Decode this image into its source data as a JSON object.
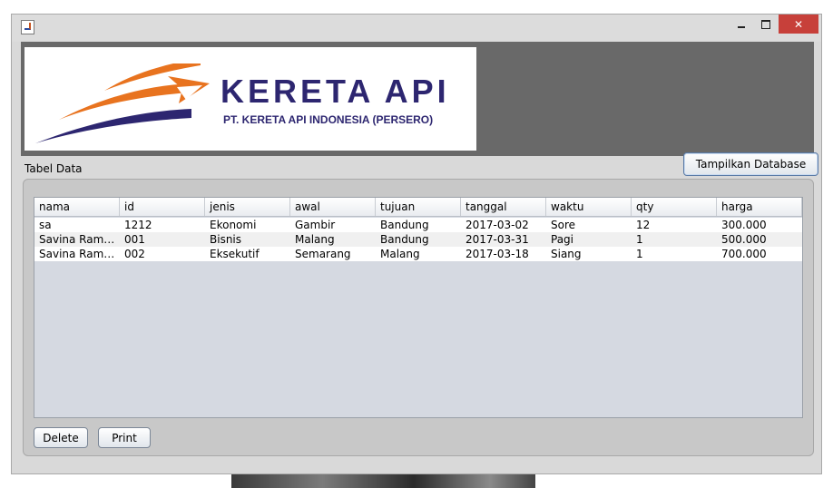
{
  "window": {
    "title": "",
    "controls": {
      "minimize": "minimize-icon",
      "maximize": "maximize-icon",
      "close": "✕"
    }
  },
  "banner": {
    "logo_title": "KERETA API",
    "logo_subtitle": "PT. KERETA API INDONESIA (PERSERO)",
    "show_db_button": "Tampilkan Database",
    "colors": {
      "navy": "#2d2670",
      "orange": "#e8731f",
      "panel": "#696969"
    }
  },
  "section": {
    "label": "Tabel Data"
  },
  "table": {
    "columns": [
      "nama",
      "id",
      "jenis",
      "awal",
      "tujuan",
      "tanggal",
      "waktu",
      "qty",
      "harga"
    ],
    "rows": [
      [
        "sa",
        "1212",
        "Ekonomi",
        "Gambir",
        "Bandung",
        "2017-03-02",
        "Sore",
        "12",
        "300.000"
      ],
      [
        "Savina Ramad...",
        "001",
        "Bisnis",
        "Malang",
        "Bandung",
        "2017-03-31",
        "Pagi",
        "1",
        "500.000"
      ],
      [
        "Savina Ramad...",
        "002",
        "Eksekutif",
        "Semarang",
        "Malang",
        "2017-03-18",
        "Siang",
        "1",
        "700.000"
      ]
    ]
  },
  "actions": {
    "delete_label": "Delete",
    "print_label": "Print"
  }
}
